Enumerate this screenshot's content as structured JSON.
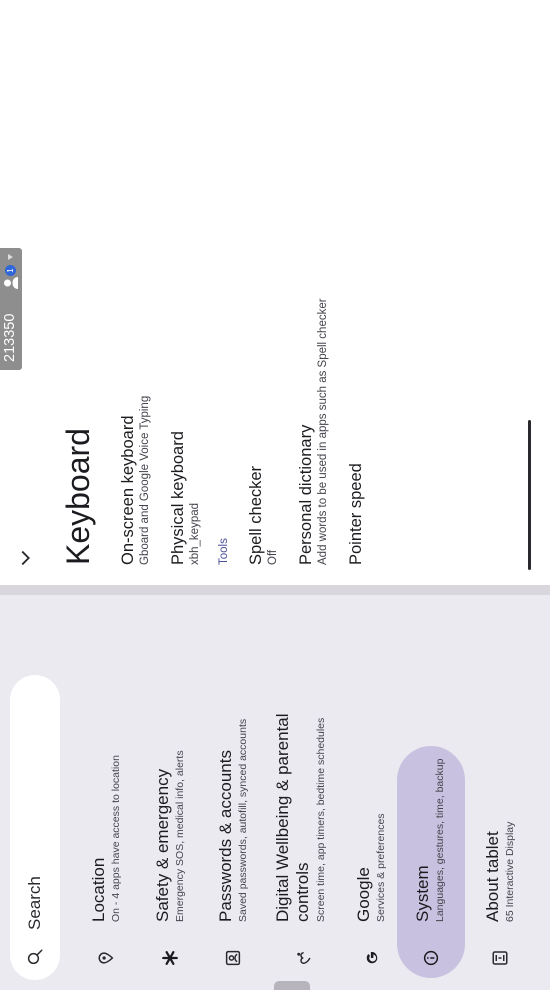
{
  "search": {
    "label": "Search"
  },
  "sidebar": {
    "items": [
      {
        "title": "Location",
        "subtitle": "On - 4 apps have access to location",
        "icon": "location-pin-icon"
      },
      {
        "title": "Safety & emergency",
        "subtitle": "Emergency SOS, medical info, alerts",
        "icon": "asterisk-icon"
      },
      {
        "title": "Passwords & accounts",
        "subtitle": "Saved passwords, autofill, synced accounts",
        "icon": "account-box-icon"
      },
      {
        "title": "Digital Wellbeing & parental controls",
        "title_line1": "Digital Wellbeing & parental",
        "title_line2": "controls",
        "subtitle": "Screen time, app timers, bedtime schedules",
        "icon": "wellbeing-icon"
      },
      {
        "title": "Google",
        "subtitle": "Services & preferences",
        "icon": "google-icon"
      },
      {
        "title": "System",
        "subtitle": "Languages, gestures, time, backup",
        "icon": "info-icon",
        "selected": true
      },
      {
        "title": "About tablet",
        "subtitle": "65 Interactive Display",
        "icon": "tablet-icon"
      }
    ]
  },
  "detail": {
    "title": "Keyboard",
    "rows": [
      {
        "title": "On-screen keyboard",
        "subtitle": "Gboard and Google Voice Typing"
      },
      {
        "title": "Physical keyboard",
        "subtitle": "xbh_keypad"
      }
    ],
    "tools_header": "Tools",
    "tool_rows": [
      {
        "title": "Spell checker",
        "subtitle": "Off"
      },
      {
        "title": "Personal dictionary",
        "subtitle": "Add words to be used in apps such as Spell checker"
      },
      {
        "title": "Pointer speed",
        "subtitle": ""
      }
    ]
  },
  "status_chip": {
    "code": "213350",
    "badge": "1"
  },
  "colors": {
    "selected": "#c9c1e0",
    "accent": "#4a4f9a",
    "panel": "#eceaf1"
  }
}
